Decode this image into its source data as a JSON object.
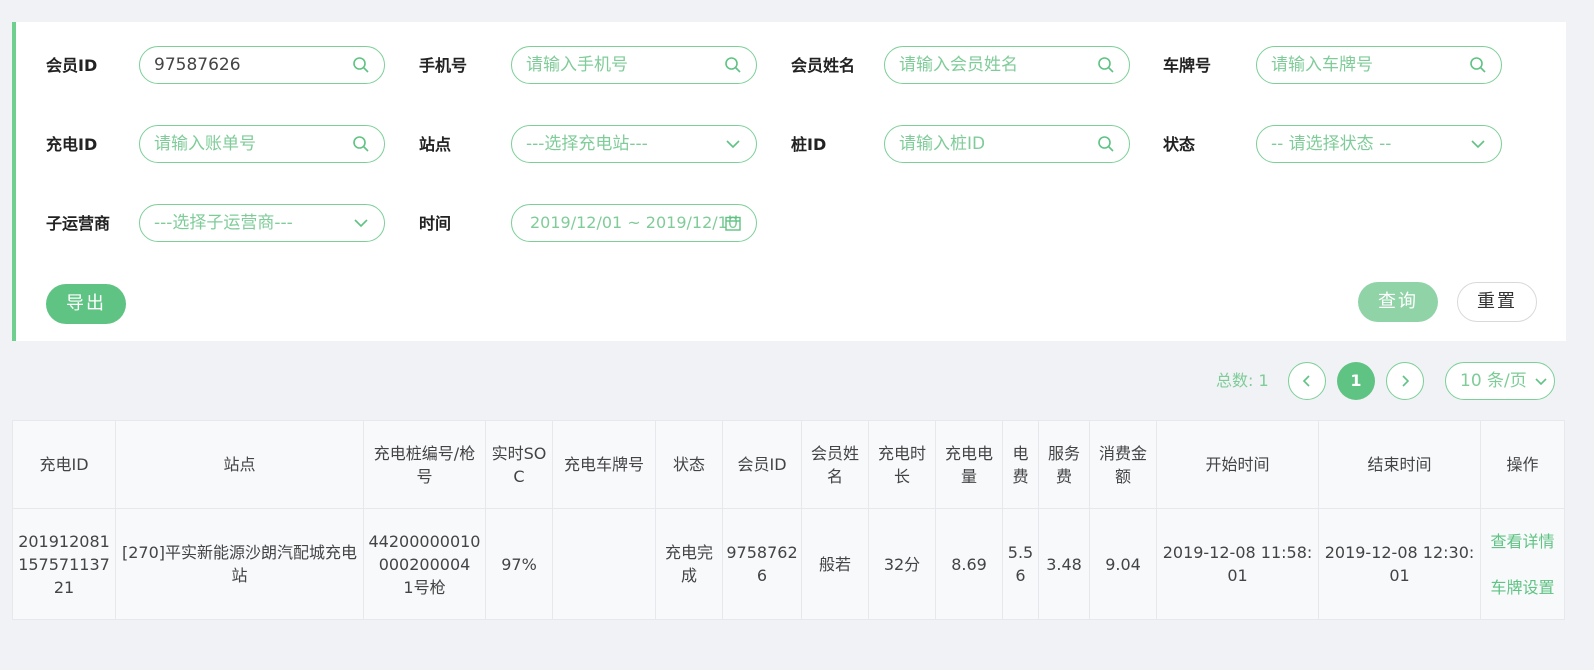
{
  "filters": {
    "member_id": {
      "label": "会员ID",
      "value": "97587626"
    },
    "phone": {
      "label": "手机号",
      "placeholder": "请输入手机号"
    },
    "member_name": {
      "label": "会员姓名",
      "placeholder": "请输入会员姓名"
    },
    "plate": {
      "label": "车牌号",
      "placeholder": "请输入车牌号"
    },
    "charge_id": {
      "label": "充电ID",
      "placeholder": "请输入账单号"
    },
    "station": {
      "label": "站点",
      "selected": "---选择充电站---"
    },
    "pile_id": {
      "label": "桩ID",
      "placeholder": "请输入桩ID"
    },
    "status": {
      "label": "状态",
      "selected": "-- 请选择状态 --"
    },
    "sub_operator": {
      "label": "子运营商",
      "selected": "---选择子运营商---"
    },
    "time": {
      "label": "时间",
      "value": "2019/12/01 ~ 2019/12/10"
    }
  },
  "actions": {
    "export": "导出",
    "query": "查询",
    "reset": "重置"
  },
  "pagination": {
    "total_label": "总数:",
    "total": "1",
    "current_page": "1",
    "page_size": "10 条/页"
  },
  "table": {
    "headers": [
      "充电ID",
      "站点",
      "充电桩编号/枪号",
      "实时SOC",
      "充电车牌号",
      "状态",
      "会员ID",
      "会员姓名",
      "充电时长",
      "充电电量",
      "电费",
      "服务费",
      "消费金额",
      "开始时间",
      "结束时间",
      "操作"
    ],
    "rows": [
      {
        "charge_id": "20191208115757113721",
        "station": "[270]平实新能源沙朗汽配城充电站",
        "pile": "44200000010000200004",
        "gun": "1号枪",
        "soc": "97%",
        "plate": "",
        "status": "充电完成",
        "member_id": "97587626",
        "member_name": "般若",
        "duration": "32分",
        "energy": "8.69",
        "electric_fee": "5.56",
        "service_fee": "3.48",
        "total": "9.04",
        "start_time": "2019-12-08 11:58:01",
        "end_time": "2019-12-08 12:30:01",
        "ops": [
          "查看详情",
          "车牌设置"
        ]
      }
    ]
  },
  "colors": {
    "accent": "#5fc383",
    "accent_light": "#8fd3a7",
    "border": "#7dcf98",
    "placeholder": "#7fcc98"
  }
}
